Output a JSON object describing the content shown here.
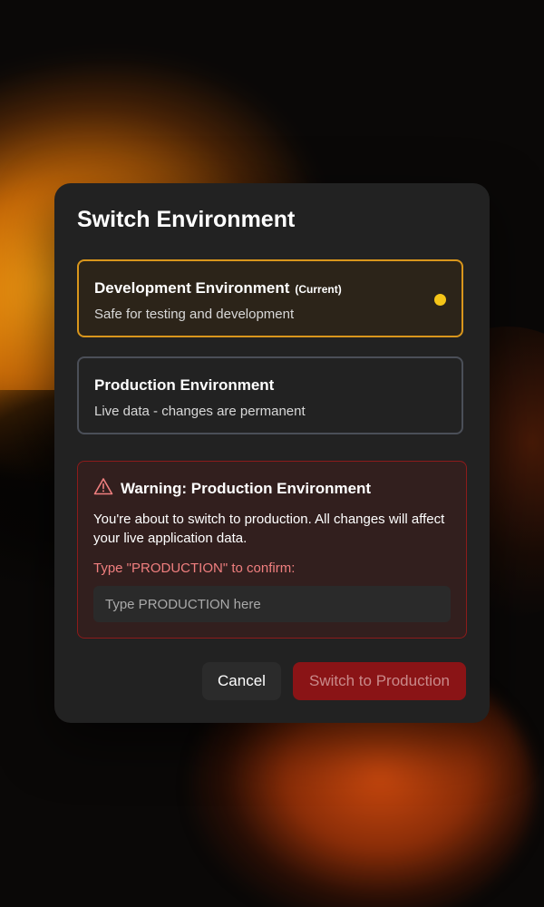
{
  "colors": {
    "modal_bg": "#222222",
    "current_border": "#d9961c",
    "current_dot": "#f5c518",
    "danger": "#8a1416",
    "warning_text": "#f07f7f"
  },
  "dialog": {
    "title": "Switch Environment",
    "environments": [
      {
        "name": "Development Environment",
        "badge": "(Current)",
        "description": "Safe for testing and development",
        "selected": true
      },
      {
        "name": "Production Environment",
        "description": "Live data - changes are permanent",
        "selected": false
      }
    ],
    "warning": {
      "icon": "warning-triangle-icon",
      "title": "Warning: Production Environment",
      "message": "You're about to switch to production. All changes will affect your live application data.",
      "confirm_label": "Type \"PRODUCTION\" to confirm:",
      "input_value": "",
      "input_placeholder": "Type PRODUCTION here"
    },
    "buttons": {
      "cancel": "Cancel",
      "confirm": "Switch to Production"
    }
  }
}
